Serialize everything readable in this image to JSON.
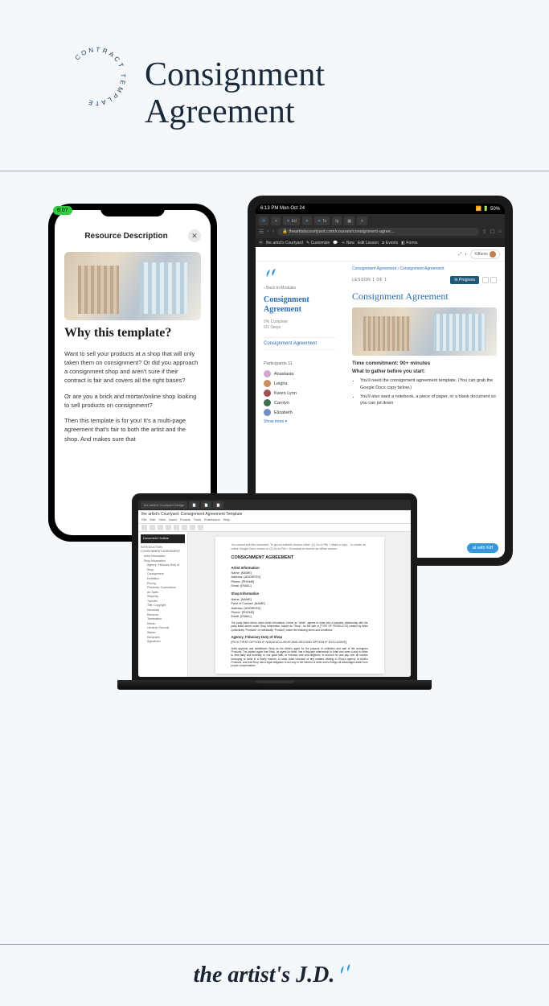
{
  "header": {
    "badge_text": "CONTRACT TEMPLATE",
    "title_line1": "Consignment",
    "title_line2": "Agreement"
  },
  "phone": {
    "pill": "6:07",
    "header_title": "Resource Description",
    "h2": "Why this template?",
    "p1": "Want to sell your products at a shop that will only taken them on consignment? Or did you approach a consignment shop and aren't sure if their contract is fair and covers all the right bases?",
    "p2": "Or are you a brick and mortar/online shop looking to sell products on consignment?",
    "p3": "Then this template is for you! It's a multi-page agreement that's fair to both the artist and the shop. And makes sure that"
  },
  "tablet": {
    "status_left": "6:13 PM  Mon Oct 24",
    "status_right": "50%",
    "url": "theartistscourtyard.com/courses/consignment-agree…",
    "toolbar": {
      "courtyard": "the artist's Courtyard",
      "customize": "Customize",
      "new": "New",
      "edit_lesson": "Edit Lesson",
      "events": "Events",
      "forms": "Forms"
    },
    "topbar_user": "Kiffanie",
    "sidebar": {
      "back": "Back to Modules",
      "title": "Consignment Agreement",
      "complete_pct": "0% Complete",
      "steps": "0/1 Steps",
      "module_link": "Consignment Agreement",
      "participants_label": "Participants",
      "participants_count": "11",
      "participants": [
        "Anastasia",
        "Leigha",
        "Karen Lynn",
        "Carolyn",
        "Elizabeth"
      ],
      "show_more": "Show more"
    },
    "main": {
      "breadcrumb": "Consignment Agreement  ›  Consignment Agreement",
      "lesson_label": "LESSON 1 OF 1",
      "badge": "In Progress",
      "h2": "Consignment Agreement",
      "time_commitment_label": "Time commitment:",
      "time_commitment_value": "90+ minutes",
      "gather_heading": "What to gather before you start:",
      "bullets": [
        "You'll need the consignment agreement template. (You can grab the Google Docs copy below.)",
        "You'll also want a notebook, a piece of paper, or a blank document so you can jot down"
      ],
      "chat": "at with Kiff"
    }
  },
  "laptop": {
    "tab1": "the artist's Courtyard Design",
    "doc_title_bar": "the artist's Courtyard: Consignment Agreement Template",
    "menu": [
      "File",
      "Edit",
      "View",
      "Insert",
      "Format",
      "Tools",
      "Extensions",
      "Help"
    ],
    "outline_header": "Document Outline",
    "outline": [
      "INTRODUCTION",
      "CONSIGNMENT AGREEMENT",
      "Artist Information",
      "Shop Information",
      "Agency; Fiduciary Duty of Shop",
      "Consignment",
      "Exhibition",
      "Pricing",
      "Proceeds; Commission",
      "Art Sales",
      "Shipping",
      "Transfer",
      "Title; Copyright",
      "Insurance",
      "Removal",
      "Termination",
      "Return",
      "General; Records",
      "Waiver",
      "Remedies",
      "Signatures"
    ],
    "page": {
      "note": "You cannot edit this document. To get an editable version either: (1) Go to File > Make a copy… to create an online Google Docs version or (2) Go to File > Download to receive an offline version.",
      "title": "CONSIGNMENT AGREEMENT",
      "artist_heading": "Artist Information",
      "artist_fields": [
        "Name: [NAME]",
        "Address: [ADDRESS]",
        "Phone: [PHONE]",
        "Email: [EMAIL]"
      ],
      "shop_heading": "Shop Information",
      "shop_fields": [
        "Name: [NAME]",
        "Point of Contact: [NAME]",
        "Address: [ADDRESS]",
        "Phone: [PHONE]",
        "Email: [EMAIL]"
      ],
      "shop_body": "The party listed above under Artist Information, herein as \"Artist\", agrees to enter into a business relationship with the party listed above under Shop Information, known as \"Shop\", for the sale of [TYPE OF PRODUCTS] created by Artist (collectively \"Products\" or individually \"Product\") under the following terms and conditions:",
      "agency_heading": "Agency; Fiduciary Duty of Shop",
      "agency_sub": "[PICK FIRST OPTION IF NON-EXCLUSIVE AND SECOND OPTION IF EXCLUSIVE]",
      "agency_body": "Artist appoints and establishes Shop as the Artist's agent for the purpose of exhibition and sale of the consigned Products. The parties agree that Shop, as agent for Artist, has a fiduciary relationship to Artist and owes a duty to Artist to deal fairly and honestly, to use good faith, to exercise care and diligence, to account for and pay over all monies belonging to Artist in a timely manner, to keep Artist informed of any matters relating to Shop's agency of Artist's Products, and that Shop has a legal obligation to act only in the interest of Artist and to forego all advantages aside from proper compensation."
    }
  },
  "footer": {
    "brand": "the artist's J.D."
  },
  "participant_colors": [
    "#d4a5c8",
    "#c89060",
    "#a05050",
    "#407050",
    "#7090c0"
  ]
}
